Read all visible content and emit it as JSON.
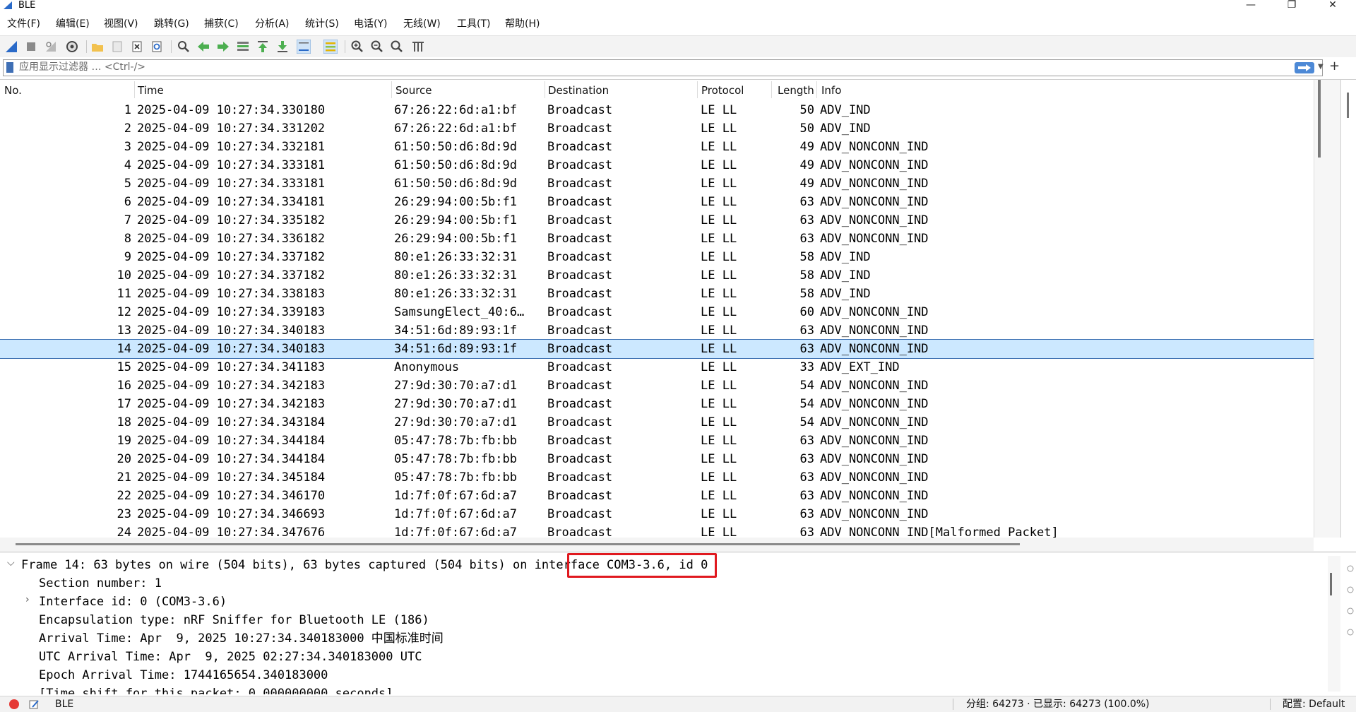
{
  "window": {
    "title": "BLE"
  },
  "menu": [
    "文件(F)",
    "编辑(E)",
    "视图(V)",
    "跳转(G)",
    "捕获(C)",
    "分析(A)",
    "统计(S)",
    "电话(Y)",
    "无线(W)",
    "工具(T)",
    "帮助(H)"
  ],
  "toolbar": {
    "icons": [
      "shark-fin-start-icon",
      "stop-capture-icon",
      "restart-capture-icon",
      "capture-options-icon",
      "open-file-icon",
      "save-file-icon",
      "close-file-icon",
      "reload-icon",
      "find-packet-icon",
      "go-back-icon",
      "go-forward-icon",
      "go-to-packet-icon",
      "first-packet-icon",
      "last-packet-icon",
      "autoscroll-icon",
      "colorize-icon",
      "zoom-in-icon",
      "zoom-out-icon",
      "zoom-normal-icon",
      "resize-columns-icon"
    ]
  },
  "filter": {
    "placeholder": "应用显示过滤器 … <Ctrl-/>",
    "value": ""
  },
  "packet_list": {
    "columns": {
      "no": "No.",
      "time": "Time",
      "source": "Source",
      "destination": "Destination",
      "protocol": "Protocol",
      "length": "Length",
      "info": "Info"
    },
    "selected_row": 13,
    "rows": [
      {
        "no": "1",
        "time": "2025-04-09 10:27:34.330180",
        "source": "67:26:22:6d:a1:bf",
        "destination": "Broadcast",
        "protocol": "LE LL",
        "length": "50",
        "info": "ADV_IND"
      },
      {
        "no": "2",
        "time": "2025-04-09 10:27:34.331202",
        "source": "67:26:22:6d:a1:bf",
        "destination": "Broadcast",
        "protocol": "LE LL",
        "length": "50",
        "info": "ADV_IND"
      },
      {
        "no": "3",
        "time": "2025-04-09 10:27:34.332181",
        "source": "61:50:50:d6:8d:9d",
        "destination": "Broadcast",
        "protocol": "LE LL",
        "length": "49",
        "info": "ADV_NONCONN_IND"
      },
      {
        "no": "4",
        "time": "2025-04-09 10:27:34.333181",
        "source": "61:50:50:d6:8d:9d",
        "destination": "Broadcast",
        "protocol": "LE LL",
        "length": "49",
        "info": "ADV_NONCONN_IND"
      },
      {
        "no": "5",
        "time": "2025-04-09 10:27:34.333181",
        "source": "61:50:50:d6:8d:9d",
        "destination": "Broadcast",
        "protocol": "LE LL",
        "length": "49",
        "info": "ADV_NONCONN_IND"
      },
      {
        "no": "6",
        "time": "2025-04-09 10:27:34.334181",
        "source": "26:29:94:00:5b:f1",
        "destination": "Broadcast",
        "protocol": "LE LL",
        "length": "63",
        "info": "ADV_NONCONN_IND"
      },
      {
        "no": "7",
        "time": "2025-04-09 10:27:34.335182",
        "source": "26:29:94:00:5b:f1",
        "destination": "Broadcast",
        "protocol": "LE LL",
        "length": "63",
        "info": "ADV_NONCONN_IND"
      },
      {
        "no": "8",
        "time": "2025-04-09 10:27:34.336182",
        "source": "26:29:94:00:5b:f1",
        "destination": "Broadcast",
        "protocol": "LE LL",
        "length": "63",
        "info": "ADV_NONCONN_IND"
      },
      {
        "no": "9",
        "time": "2025-04-09 10:27:34.337182",
        "source": "80:e1:26:33:32:31",
        "destination": "Broadcast",
        "protocol": "LE LL",
        "length": "58",
        "info": "ADV_IND"
      },
      {
        "no": "10",
        "time": "2025-04-09 10:27:34.337182",
        "source": "80:e1:26:33:32:31",
        "destination": "Broadcast",
        "protocol": "LE LL",
        "length": "58",
        "info": "ADV_IND"
      },
      {
        "no": "11",
        "time": "2025-04-09 10:27:34.338183",
        "source": "80:e1:26:33:32:31",
        "destination": "Broadcast",
        "protocol": "LE LL",
        "length": "58",
        "info": "ADV_IND"
      },
      {
        "no": "12",
        "time": "2025-04-09 10:27:34.339183",
        "source": "SamsungElect_40:6…",
        "destination": "Broadcast",
        "protocol": "LE LL",
        "length": "60",
        "info": "ADV_NONCONN_IND"
      },
      {
        "no": "13",
        "time": "2025-04-09 10:27:34.340183",
        "source": "34:51:6d:89:93:1f",
        "destination": "Broadcast",
        "protocol": "LE LL",
        "length": "63",
        "info": "ADV_NONCONN_IND"
      },
      {
        "no": "14",
        "time": "2025-04-09 10:27:34.340183",
        "source": "34:51:6d:89:93:1f",
        "destination": "Broadcast",
        "protocol": "LE LL",
        "length": "63",
        "info": "ADV_NONCONN_IND"
      },
      {
        "no": "15",
        "time": "2025-04-09 10:27:34.341183",
        "source": "Anonymous",
        "destination": "Broadcast",
        "protocol": "LE LL",
        "length": "33",
        "info": "ADV_EXT_IND"
      },
      {
        "no": "16",
        "time": "2025-04-09 10:27:34.342183",
        "source": "27:9d:30:70:a7:d1",
        "destination": "Broadcast",
        "protocol": "LE LL",
        "length": "54",
        "info": "ADV_NONCONN_IND"
      },
      {
        "no": "17",
        "time": "2025-04-09 10:27:34.342183",
        "source": "27:9d:30:70:a7:d1",
        "destination": "Broadcast",
        "protocol": "LE LL",
        "length": "54",
        "info": "ADV_NONCONN_IND"
      },
      {
        "no": "18",
        "time": "2025-04-09 10:27:34.343184",
        "source": "27:9d:30:70:a7:d1",
        "destination": "Broadcast",
        "protocol": "LE LL",
        "length": "54",
        "info": "ADV_NONCONN_IND"
      },
      {
        "no": "19",
        "time": "2025-04-09 10:27:34.344184",
        "source": "05:47:78:7b:fb:bb",
        "destination": "Broadcast",
        "protocol": "LE LL",
        "length": "63",
        "info": "ADV_NONCONN_IND"
      },
      {
        "no": "20",
        "time": "2025-04-09 10:27:34.344184",
        "source": "05:47:78:7b:fb:bb",
        "destination": "Broadcast",
        "protocol": "LE LL",
        "length": "63",
        "info": "ADV_NONCONN_IND"
      },
      {
        "no": "21",
        "time": "2025-04-09 10:27:34.345184",
        "source": "05:47:78:7b:fb:bb",
        "destination": "Broadcast",
        "protocol": "LE LL",
        "length": "63",
        "info": "ADV_NONCONN_IND"
      },
      {
        "no": "22",
        "time": "2025-04-09 10:27:34.346170",
        "source": "1d:7f:0f:67:6d:a7",
        "destination": "Broadcast",
        "protocol": "LE LL",
        "length": "63",
        "info": "ADV_NONCONN_IND"
      },
      {
        "no": "23",
        "time": "2025-04-09 10:27:34.346693",
        "source": "1d:7f:0f:67:6d:a7",
        "destination": "Broadcast",
        "protocol": "LE LL",
        "length": "63",
        "info": "ADV_NONCONN_IND"
      },
      {
        "no": "24",
        "time": "2025-04-09 10:27:34.347676",
        "source": "1d:7f:0f:67:6d:a7",
        "destination": "Broadcast",
        "protocol": "LE LL",
        "length": "63",
        "info": "ADV_NONCONN_IND[Malformed Packet]"
      }
    ]
  },
  "details": {
    "frame_prefix": "Frame 14: 63 bytes on wire (504 bits), 63 bytes captured (504 bits) on ",
    "frame_highlight": "interface COM3-3.6",
    "frame_suffix": ", id 0",
    "lines": [
      "Section number: 1",
      "Interface id: 0 (COM3-3.6)",
      "Encapsulation type: nRF Sniffer for Bluetooth LE (186)",
      "Arrival Time: Apr  9, 2025 10:27:34.340183000 中国标准时间",
      "UTC Arrival Time: Apr  9, 2025 02:27:34.340183000 UTC",
      "Epoch Arrival Time: 1744165654.340183000",
      "[Time shift for this packet: 0.000000000 seconds]"
    ]
  },
  "status": {
    "file": "BLE",
    "packets": "分组: 64273 · 已显示: 64273 (100.0%)",
    "profile": "配置: Default"
  },
  "colors": {
    "selection": "#cce8ff",
    "highlight_box": "#e0191f",
    "accent": "#3f6fb5"
  }
}
